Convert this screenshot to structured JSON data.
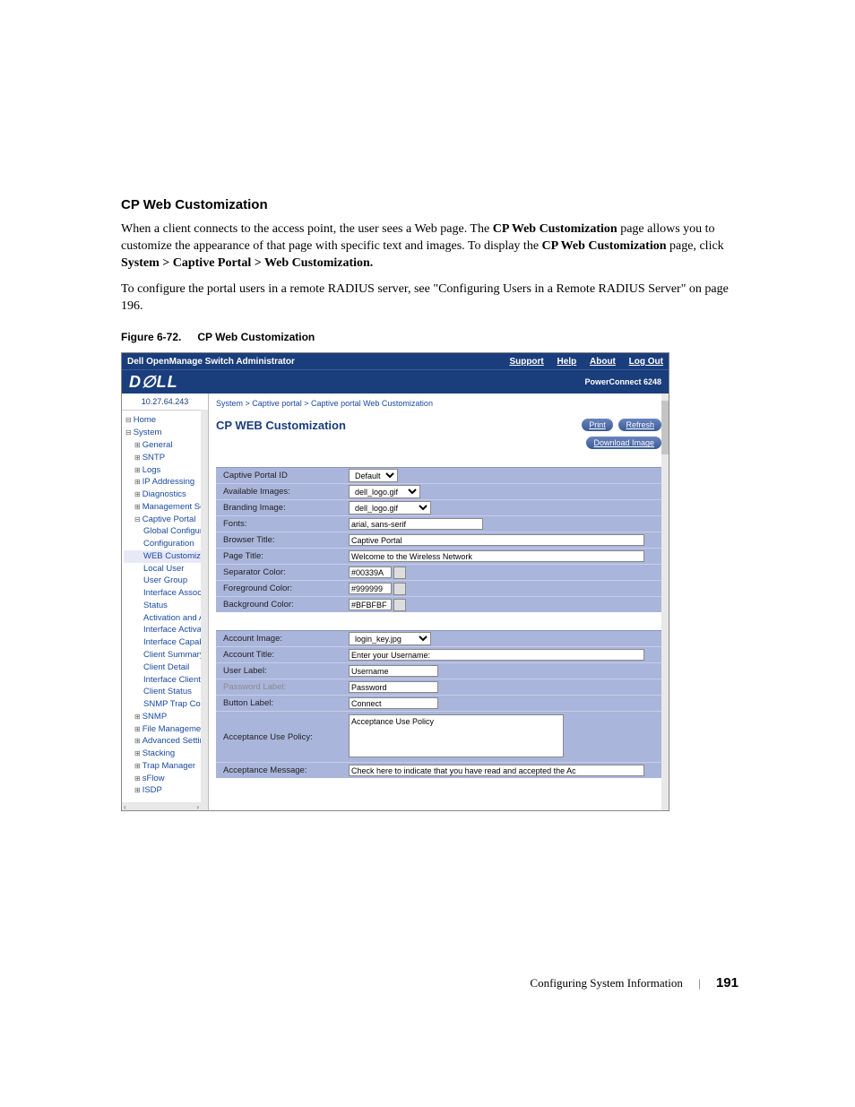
{
  "section": {
    "title": "CP Web Customization",
    "p1_a": "When a client connects to the access point, the user sees a Web page. The ",
    "p1_b": "CP Web Customization",
    "p1_c": " page allows you to customize the appearance of that page with specific text and images. To display the ",
    "p1_d": "CP Web Customization",
    "p1_e": " page, click ",
    "p1_f": "System > Captive Portal > Web Customization.",
    "p2": "To configure the portal users in a remote RADIUS server, see \"Configuring Users in a Remote RADIUS Server\" on page 196."
  },
  "figure": {
    "num": "Figure 6-72.",
    "title": "CP Web Customization"
  },
  "ss": {
    "title": "Dell OpenManage Switch Administrator",
    "nav": {
      "support": "Support",
      "help": "Help",
      "about": "About",
      "logout": "Log Out"
    },
    "brand": {
      "logo": "D∅LL",
      "model": "PowerConnect 6248"
    },
    "ip": "10.27.64.243",
    "tree": {
      "home": "Home",
      "system": "System",
      "general": "General",
      "sntp": "SNTP",
      "logs": "Logs",
      "ipaddr": "IP Addressing",
      "diag": "Diagnostics",
      "mgmtsec": "Management Securi",
      "captive": "Captive Portal",
      "gc": "Global Configurat",
      "conf": "Configuration",
      "webcust": "WEB Customiza",
      "localuser": "Local User",
      "usergroup": "User Group",
      "ifassoc": "Interface Associa",
      "status": "Status",
      "actauth": "Activation and Au",
      "ifactiv": "Interface Activatio",
      "ifcapab": "Interface Capabili",
      "clsum": "Client Summary",
      "cldet": "Client Detail",
      "ifcls": "Interface Client S",
      "clstat": "Client Status",
      "snmptrap": "SNMP Trap Conf",
      "snmp": "SNMP",
      "filemgmt": "File Management",
      "advset": "Advanced Settings",
      "stacking": "Stacking",
      "trapmgr": "Trap Manager",
      "sflow": "sFlow",
      "isdp": "ISDP"
    },
    "breadcrumb": "System > Captive portal > Captive portal Web Customization",
    "panelTitle": "CP WEB Customization",
    "btn": {
      "print": "Print",
      "refresh": "Refresh",
      "download": "Download Image"
    },
    "form1": {
      "cpId": {
        "l": "Captive Portal ID",
        "v": "Default"
      },
      "avail": {
        "l": "Available Images:",
        "v": "dell_logo.gif"
      },
      "brand": {
        "l": "Branding Image:",
        "v": "dell_logo.gif"
      },
      "fonts": {
        "l": "Fonts:",
        "v": "arial, sans-serif"
      },
      "btitle": {
        "l": "Browser Title:",
        "v": "Captive Portal"
      },
      "ptitle": {
        "l": "Page Title:",
        "v": "Welcome to the Wireless Network"
      },
      "sep": {
        "l": "Separator Color:",
        "v": "#00339A"
      },
      "fg": {
        "l": "Foreground Color:",
        "v": "#999999"
      },
      "bg": {
        "l": "Background Color:",
        "v": "#BFBFBF"
      }
    },
    "form2": {
      "aimg": {
        "l": "Account Image:",
        "v": "login_key.jpg"
      },
      "atit": {
        "l": "Account Title:",
        "v": "Enter your Username:"
      },
      "ulbl": {
        "l": "User Label:",
        "v": "Username"
      },
      "plbl": {
        "l": "Password Label:",
        "v": "Password"
      },
      "blbl": {
        "l": "Button Label:",
        "v": "Connect"
      },
      "aup": {
        "l": "Acceptance Use Policy:",
        "v": "Acceptance Use Policy"
      },
      "amsg": {
        "l": "Acceptance Message:",
        "v": "Check here to indicate that you have read and accepted the Ac"
      }
    }
  },
  "footer": {
    "section": "Configuring System Information",
    "page": "191"
  }
}
